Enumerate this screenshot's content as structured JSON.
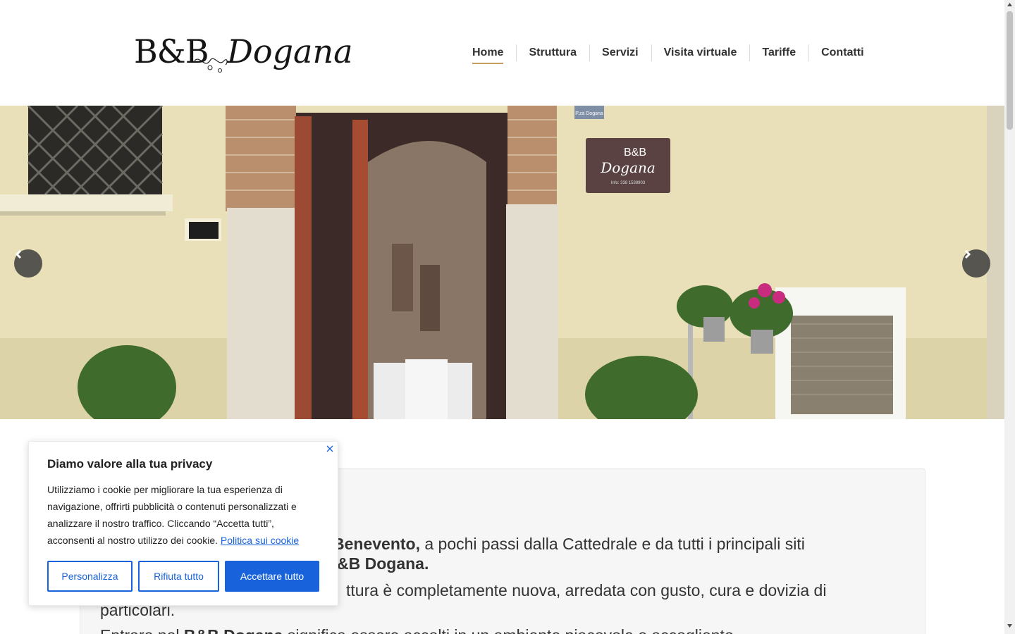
{
  "logo": {
    "left": "B&B",
    "right": "Dogana"
  },
  "nav": {
    "items": [
      {
        "label": "Home"
      },
      {
        "label": "Struttura"
      },
      {
        "label": "Servizi"
      },
      {
        "label": "Visita virtuale"
      },
      {
        "label": "Tariffe"
      },
      {
        "label": "Contatti"
      }
    ]
  },
  "hero": {
    "sign_line1": "B&B",
    "sign_line2": "Dogana",
    "sign_info": "Info: 338 1538903",
    "street_sign": "P.za Dogana",
    "prev_icon": "chevron-left-icon",
    "next_icon": "chevron-right-icon"
  },
  "content": {
    "p1_bold": "Benevento,",
    "p1_text": " a pochi passi dalla Cattedrale e da tutti i principali siti",
    "p1b_bold": "&B Dogana.",
    "p2_text": "ttura è completamente nuova, arredata con gusto, cura e dovizia di",
    "p2b_text": "particolari.",
    "p3_text1": "Entrare nel ",
    "p3_bold": "B&B Dogana",
    "p3_text2": " significa essere accolti in un ambiente piacevole e accogliente."
  },
  "cookie": {
    "title": "Diamo valore alla tua privacy",
    "body": "Utilizziamo i cookie per migliorare la tua esperienza di navigazione, offrirti pubblicità o contenuti personalizzati e analizzare il nostro traffico. Cliccando “Accetta tutti”, acconsenti al nostro utilizzo dei cookie. ",
    "link": "Politica sui cookie",
    "btn_customize": "Personalizza",
    "btn_reject": "Rifiuta tutto",
    "btn_accept": "Accettare tutto",
    "accent_color": "#1863dc"
  },
  "colors": {
    "nav_active_underline": "#c59d5f"
  }
}
